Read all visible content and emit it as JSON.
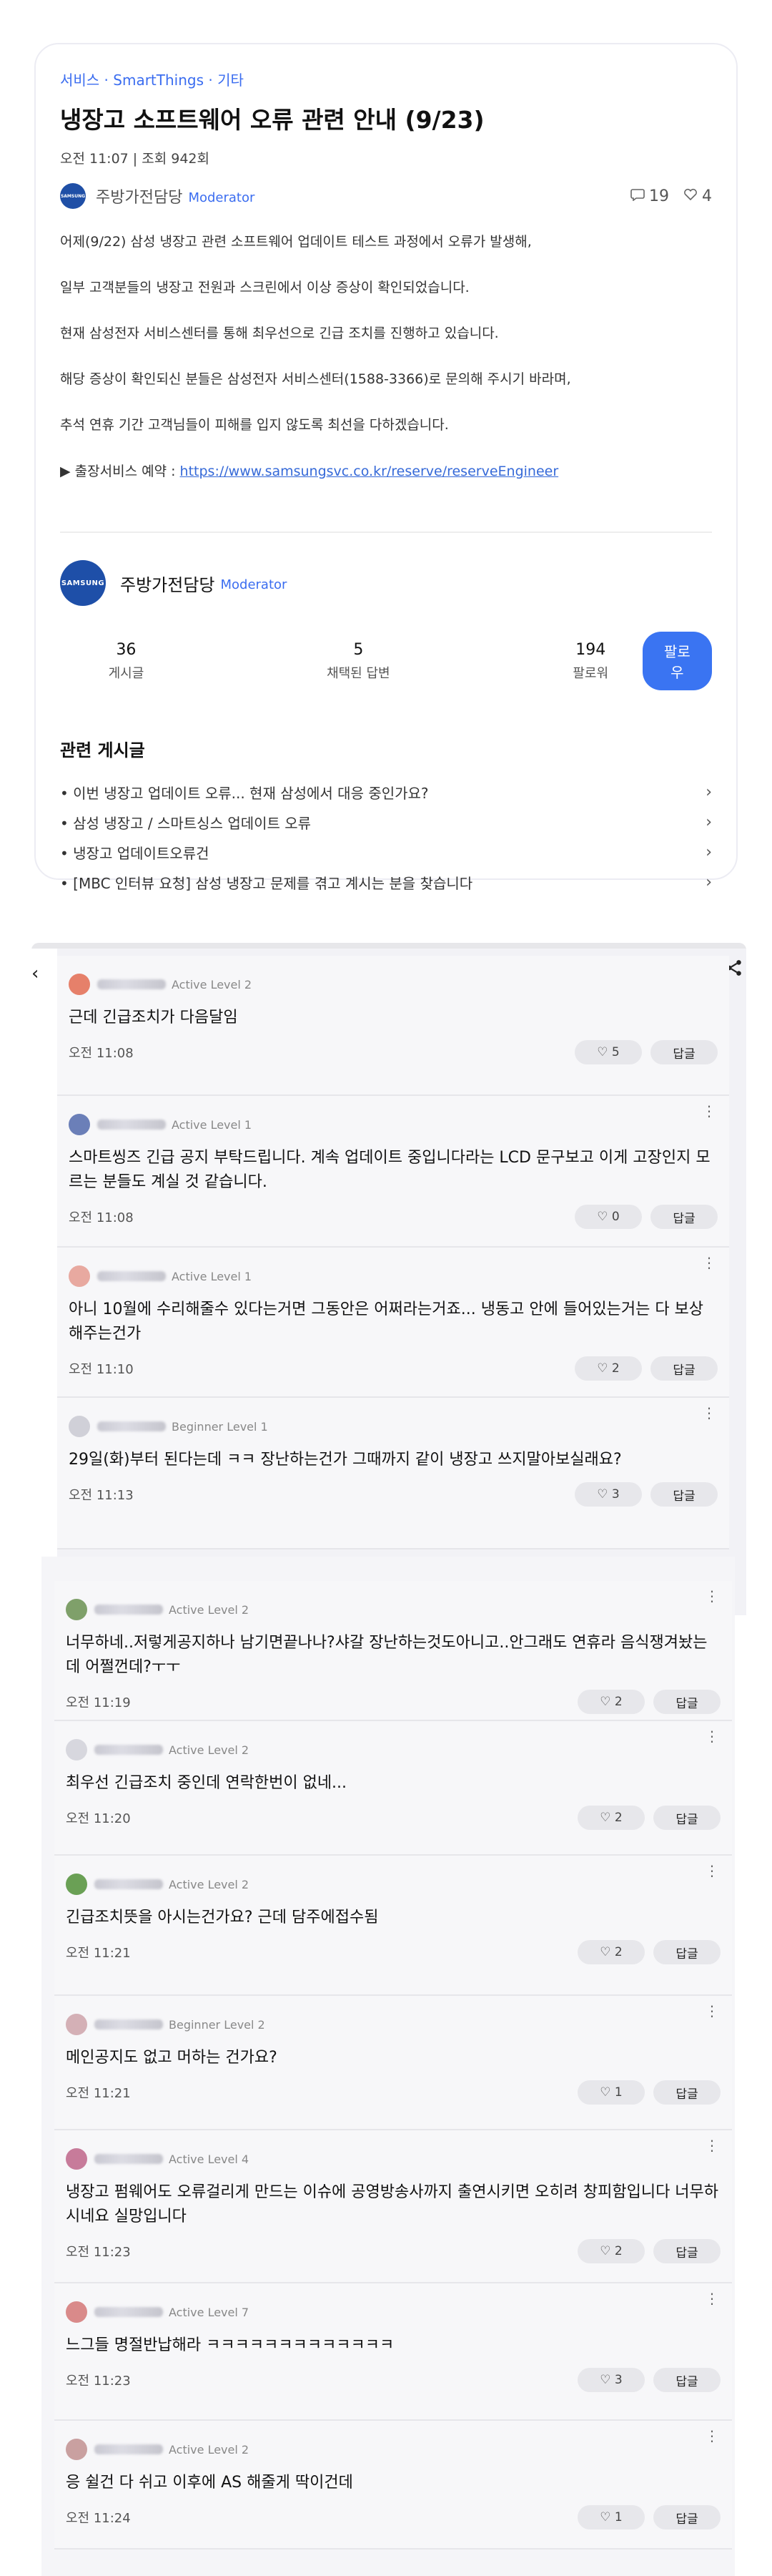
{
  "post": {
    "breadcrumb": "서비스 · SmartThings · 기타",
    "title": "냉장고 소프트웨어 오류 관련 안내 (9/23)",
    "meta": "오전 11:07  |  조회 942회",
    "author": "주방가전담당",
    "moderator": "Moderator",
    "comment_count": "19",
    "like_count": "4",
    "logo_text": "SAMSUNG",
    "paragraphs": [
      "어제(9/22) 삼성 냉장고 관련 소프트웨어 업데이트 테스트 과정에서 오류가 발생해,",
      "일부 고객분들의 냉장고 전원과 스크린에서 이상 증상이 확인되었습니다.",
      "현재 삼성전자 서비스센터를 통해 최우선으로 긴급 조치를 진행하고 있습니다.",
      "해당 증상이 확인되신 분들은 삼성전자 서비스센터(1588-3366)로 문의해 주시기 바라며,",
      "추석 연휴 기간 고객님들이 피해를 입지 않도록 최선을 다하겠습니다."
    ],
    "link_prefix": "▶ 출장서비스 예약 : ",
    "link_text": "https://www.samsungsvc.co.kr/reserve/reserveEngineer"
  },
  "author_card": {
    "name": "주방가전담당",
    "moderator": "Moderator",
    "logo_text": "SAMSUNG",
    "stats": [
      {
        "num": "36",
        "label": "게시글"
      },
      {
        "num": "5",
        "label": "채택된 답변"
      },
      {
        "num": "194",
        "label": "팔로워"
      }
    ],
    "follow_label": "팔로우"
  },
  "related": {
    "heading": "관련 게시글",
    "items": [
      "• 이번 냉장고 업데이트 오류... 현재 삼성에서 대응 중인가요?",
      "• 삼성 냉장고 / 스마트싱스 업데이트 오류",
      "• 냉장고 업데이트오류건",
      "• [MBC 인터뷰 요청] 삼성 냉장고 문제를 겪고 계시는 분을 찾습니다"
    ]
  },
  "comments_a": [
    {
      "level": "Active Level 2",
      "text": "근데 긴급조치가 다음달임",
      "time": "오전 11:08",
      "likes": "5",
      "avatar_color": "#e6806a"
    },
    {
      "level": "Active Level 1",
      "text": "스마트씽즈 긴급 공지 부탁드립니다. 계속 업데이트 중입니다라는 LCD 문구보고 이게 고장인지 모르는 분들도 계실 것 같습니다.",
      "time": "오전 11:08",
      "likes": "0",
      "avatar_color": "#6b7fb8"
    },
    {
      "level": "Active Level 1",
      "text": "아니 10월에 수리해줄수 있다는거면 그동안은 어쩌라는거죠... 냉동고 안에 들어있는거는 다 보상 해주는건가",
      "time": "오전 11:10",
      "likes": "2",
      "avatar_color": "#e8a9a0"
    },
    {
      "level": "Beginner Level 1",
      "text": "29일(화)부터 된다는데 ㅋㅋ 장난하는건가 그때까지 같이 냉장고 쓰지말아보실래요?",
      "time": "오전 11:13",
      "likes": "3",
      "avatar_color": "#d0d0d8"
    }
  ],
  "comments_b": [
    {
      "level": "Active Level 2",
      "text": "너무하네..저렇게공지하나 남기면끝나나?샤갈 장난하는것도아니고..안그래도 연휴라 음식쟁겨놨는데 어쩔껀데?ㅜㅜ",
      "time": "오전 11:19",
      "likes": "2",
      "avatar_color": "#7fa06a"
    },
    {
      "level": "Active Level 2",
      "text": "최우선 긴급조치 중인데 연락한번이 없네...",
      "time": "오전 11:20",
      "likes": "2",
      "avatar_color": "#d7d7de"
    },
    {
      "level": "Active Level 2",
      "text": "긴급조치뜻을 아시는건가요? 근데 담주에접수됨",
      "time": "오전 11:21",
      "likes": "2",
      "avatar_color": "#6aa055"
    },
    {
      "level": "Beginner Level 2",
      "text": "메인공지도 없고 머하는 건가요?",
      "time": "오전 11:21",
      "likes": "1",
      "avatar_color": "#d4b0b6"
    },
    {
      "level": "Active Level 4",
      "text": "냉장고 펌웨어도 오류걸리게 만드는 이슈에 공영방송사까지 출연시키면 오히려 창피함입니다 너무하시네요 실망입니다",
      "time": "오전 11:23",
      "likes": "2",
      "avatar_color": "#c77b9a"
    },
    {
      "level": "Active Level 7",
      "text": "느그들 명절반납해라 ㅋㅋㅋㅋㅋㅋㅋㅋㅋㅋㅋㅋㅋ",
      "time": "오전 11:23",
      "likes": "3",
      "avatar_color": "#d98a8a"
    },
    {
      "level": "Active Level 2",
      "text": "응 쉴건 다 쉬고 이후에 AS 해줄게 딱이건데",
      "time": "오전 11:24",
      "likes": "1",
      "avatar_color": "#c9a0a0"
    }
  ],
  "ui": {
    "reply_label": "답글",
    "heart": "♡",
    "comment_icon": "▢",
    "share_icon": "share-icon",
    "back_icon": "‹",
    "more_icon": "⋮"
  }
}
